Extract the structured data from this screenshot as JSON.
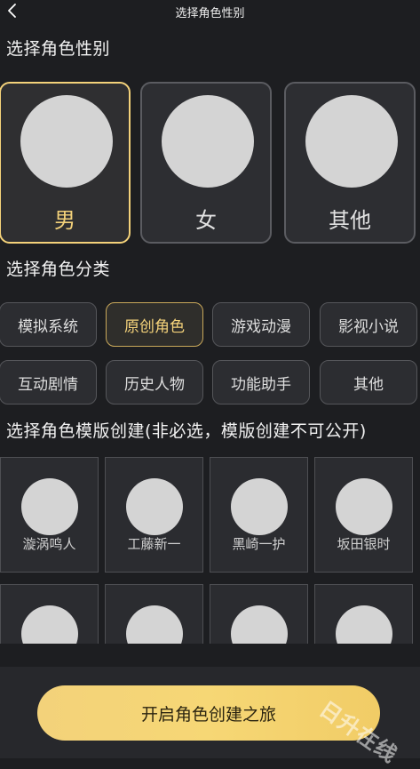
{
  "header": {
    "title": "选择角色性别"
  },
  "gender_section": {
    "title": "选择角色性别",
    "options": [
      {
        "label": "男",
        "selected": true
      },
      {
        "label": "女",
        "selected": false
      },
      {
        "label": "其他",
        "selected": false
      }
    ]
  },
  "category_section": {
    "title": "选择角色分类",
    "chips": [
      {
        "label": "模拟系统",
        "selected": false
      },
      {
        "label": "原创角色",
        "selected": true
      },
      {
        "label": "游戏动漫",
        "selected": false
      },
      {
        "label": "影视小说",
        "selected": false
      },
      {
        "label": "互动剧情",
        "selected": false
      },
      {
        "label": "历史人物",
        "selected": false
      },
      {
        "label": "功能助手",
        "selected": false
      },
      {
        "label": "其他",
        "selected": false
      }
    ]
  },
  "template_section": {
    "title": "选择角色模版创建(非必选，模版创建不可公开)",
    "templates": [
      {
        "name": "漩涡鸣人"
      },
      {
        "name": "工藤新一"
      },
      {
        "name": "黑崎一护"
      },
      {
        "name": "坂田银时"
      }
    ]
  },
  "footer": {
    "cta_label": "开启角色创建之旅"
  },
  "watermark": {
    "text": "日升在线"
  },
  "colors": {
    "accent": "#f4d27a",
    "background": "#1d1e21",
    "card": "#2d2e32"
  },
  "icons": {
    "back": "chevron-left-icon"
  }
}
